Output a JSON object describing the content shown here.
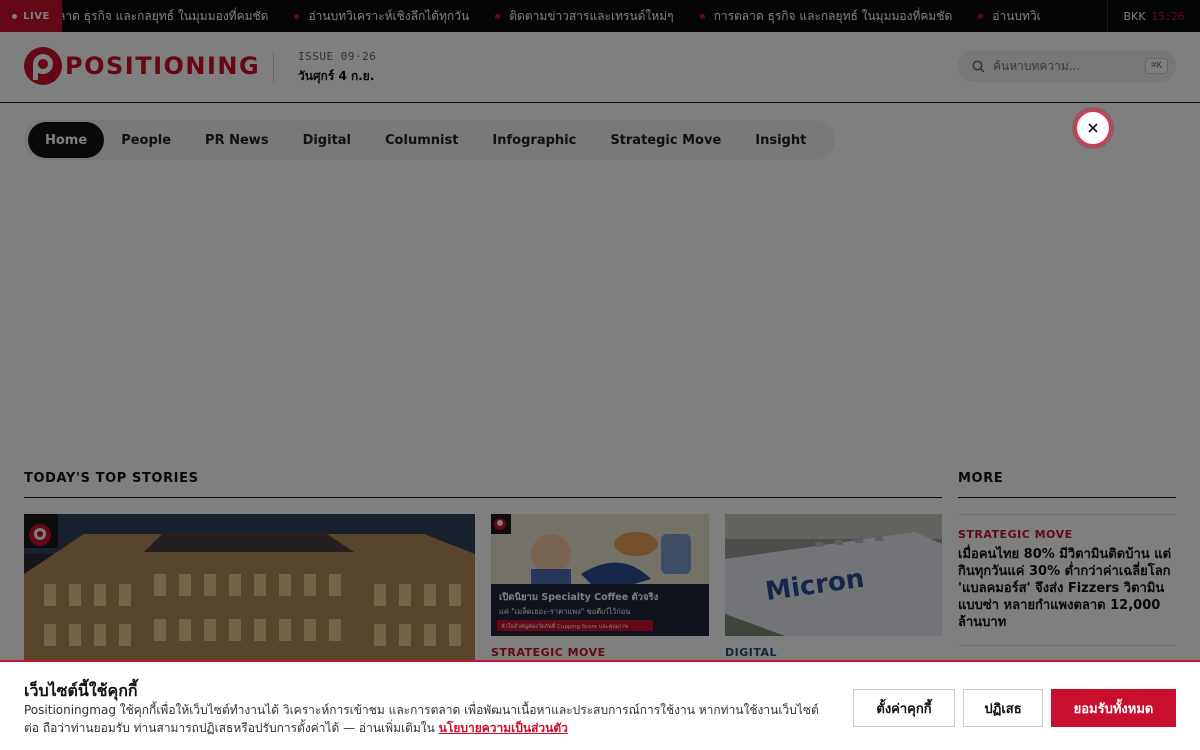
{
  "ticker": {
    "live_label": "LIVE",
    "items": [
      "ลาด ธุรกิจ และกลยุทธ์ ในมุมมองที่คมชัด",
      "อ่านบทวิเคราะห์เชิงลึกได้ทุกวัน",
      "ติดตามข่าวสารและเทรนด์ใหม่ๆ",
      "การตลาด ธุรกิจ และกลยุทธ์ ในมุมมองที่คมชัด",
      "อ่านบทวิเ"
    ],
    "city": "BKK",
    "time": "15:26"
  },
  "header": {
    "logo_text": "POSITIONING",
    "issue": "ISSUE 09·26",
    "date": "วันศุกร์ 4 ก.ย.",
    "search_placeholder": "ค้นหาบทความ...",
    "search_shortcut": "⌘K"
  },
  "nav": {
    "items": [
      "Home",
      "People",
      "PR News",
      "Digital",
      "Columnist",
      "Infographic",
      "Strategic Move",
      "Insight"
    ],
    "active": "Home"
  },
  "sections": {
    "top_stories": "TODAY'S TOP STORIES",
    "more": "MORE"
  },
  "cards": [
    {
      "category": "STRATEGIC MOVE",
      "image_title": "เปิดนิยาม Specialty Coffee ตัวจริง",
      "image_subtitle": "แค่ \"เมล็ดเยอะ-ราคาแพง\" ขอตีเก๋ไว้ก่อน",
      "image_tag": "หัวใจสำคัญต้องวัดกันที่ Cupping Score และคุณภาพ"
    },
    {
      "category": "DIGITAL",
      "image_brand": "Micron"
    }
  ],
  "more_story": {
    "category": "STRATEGIC MOVE",
    "headline": "เมื่อคนไทย 80% มีวิตามินติดบ้าน แต่กินทุกวันแค่ 30% ต่ำกว่าค่าเฉลี่ยโลก 'แบลคมอร์ส' จึงส่ง Fizzers วิตามินแบบซ่า หลายกำแพงตลาด 12,000 ล้านบาท"
  },
  "cookie": {
    "title": "เว็บไซต์นี้ใช้คุกกี้",
    "text": "Positioningmag ใช้คุกกี้เพื่อให้เว็บไซต์ทำงานได้ วิเคราะห์การเข้าชม และการตลาด เพื่อพัฒนาเนื้อหาและประสบการณ์การใช้งาน หากท่านใช้งานเว็บไซต์ต่อ ถือว่าท่านยอมรับ ท่านสามารถปฏิเสธหรือปรับการตั้งค่าได้ — อ่านเพิ่มเติมใน",
    "policy_link": "นโยบายความเป็นส่วนตัว",
    "settings_label": "ตั้งค่าคุกกี้",
    "reject_label": "ปฏิเสธ",
    "accept_label": "ยอมรับทั้งหมด"
  },
  "colors": {
    "brand": "#c8102e",
    "dark": "#0b0b0b",
    "digital": "#1f4e79"
  }
}
